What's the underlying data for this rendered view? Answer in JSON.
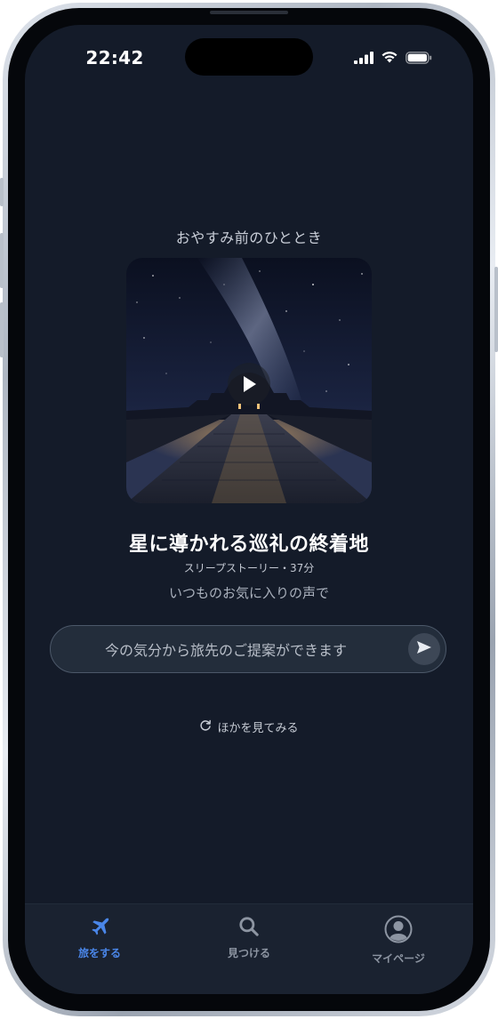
{
  "status_bar": {
    "time": "22:42",
    "icons": [
      "cellular-signal-icon",
      "wifi-icon",
      "battery-icon"
    ]
  },
  "hero": {
    "kicker": "おやすみ前のひととき",
    "artwork_icon": "play-icon",
    "title": "星に導かれる巡礼の終着地",
    "meta": "スリープストーリー・37分",
    "voice_note": "いつものお気に入りの声で"
  },
  "prompt": {
    "placeholder": "今の気分から旅先のご提案ができます",
    "value": "",
    "send_icon": "send-icon"
  },
  "more": {
    "icon": "refresh-icon",
    "label": "ほかを見てみる"
  },
  "tab_bar": {
    "active_color": "#4a86e8",
    "inactive_color": "#8d95a2",
    "items": [
      {
        "label": "旅をする",
        "icon": "airplane-icon",
        "active": true
      },
      {
        "label": "見つける",
        "icon": "search-icon",
        "active": false
      },
      {
        "label": "マイページ",
        "icon": "user-icon",
        "active": false
      }
    ]
  }
}
